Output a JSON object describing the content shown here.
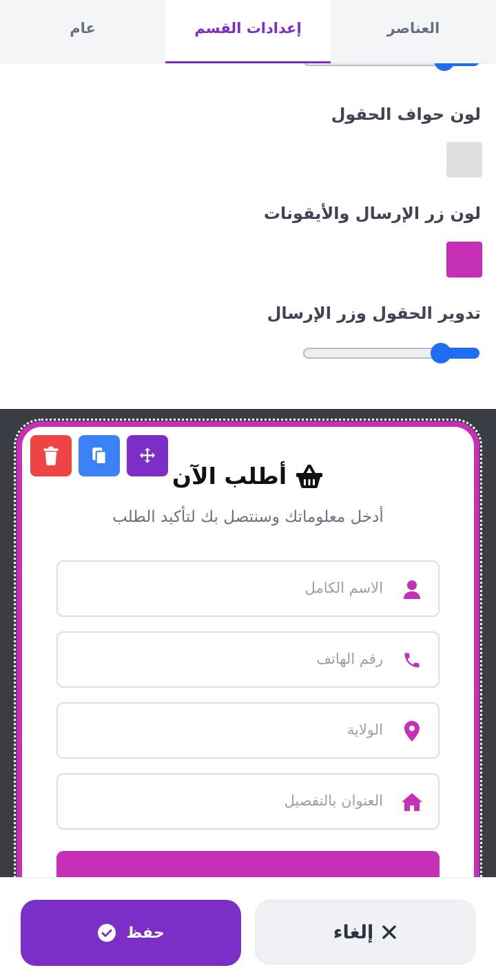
{
  "tabs": [
    {
      "label": "العناصر",
      "active": false
    },
    {
      "label": "إعدادات القسم",
      "active": true
    },
    {
      "label": "عام",
      "active": false
    }
  ],
  "settings": {
    "top_slider_value": 0.8,
    "field_border_color_label": "لون حواف الحقول",
    "field_border_color": "#e0e0e0",
    "submit_icon_color_label": "لون زر الإرسال والأيقونات",
    "submit_icon_color": "#c630b8",
    "rounding_label": "تدوير الحقول وزر الإرسال",
    "rounding_value": 0.78
  },
  "preview": {
    "title": "أطلب الآن",
    "subtitle": "أدخل معلوماتك وسنتصل بك لتأكيد الطلب",
    "fields": [
      {
        "placeholder": "الاسم الكامل",
        "icon": "user-icon"
      },
      {
        "placeholder": "رقم الهاتف",
        "icon": "phone-icon"
      },
      {
        "placeholder": "الولاية",
        "icon": "location-pin-icon"
      },
      {
        "placeholder": "العنوان بالتفصيل",
        "icon": "home-icon"
      }
    ],
    "accent_color": "#c630b8"
  },
  "footer": {
    "cancel_label": "إلغاء",
    "save_label": "حفظ"
  }
}
